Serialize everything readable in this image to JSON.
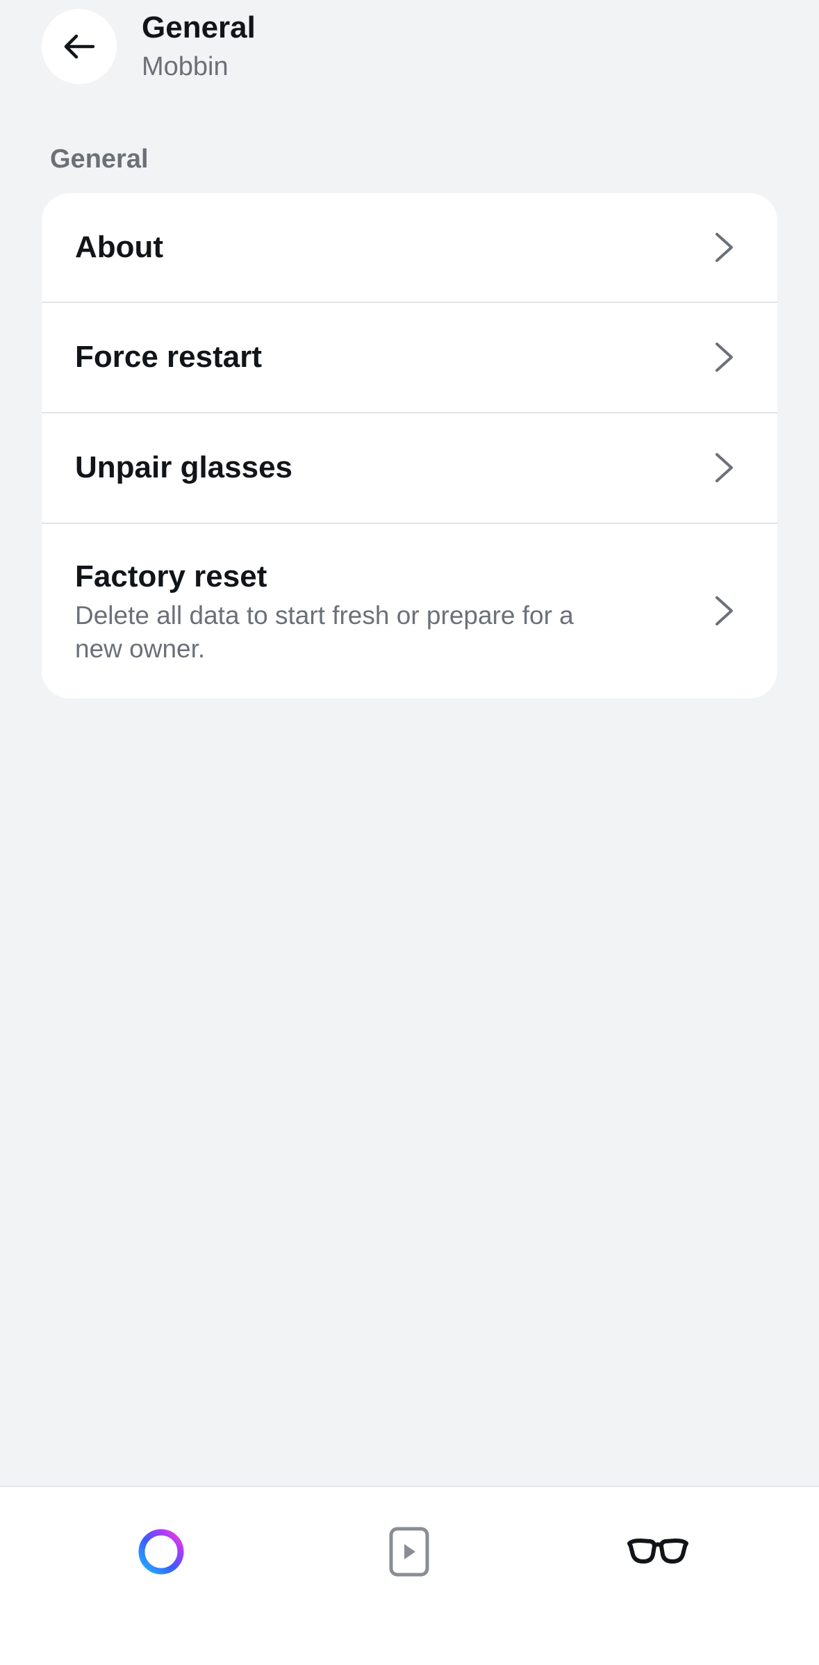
{
  "header": {
    "title": "General",
    "subtitle": "Mobbin",
    "back_icon": "arrow-left-icon"
  },
  "section": {
    "label": "General"
  },
  "settings": {
    "items": [
      {
        "label": "About",
        "icon": "chevron-right-icon"
      },
      {
        "label": "Force restart",
        "icon": "chevron-right-icon"
      },
      {
        "label": "Unpair glasses",
        "icon": "chevron-right-icon"
      },
      {
        "label": "Factory reset",
        "description": "Delete all data to start fresh or prepare for a new owner.",
        "icon": "chevron-right-icon"
      }
    ]
  },
  "bottom_nav": {
    "items": [
      {
        "icon": "meta-ai-ring-icon"
      },
      {
        "icon": "media-play-icon"
      },
      {
        "icon": "glasses-icon"
      }
    ]
  },
  "colors": {
    "background": "#f2f3f5",
    "card": "#ffffff",
    "primary_text": "#111418",
    "secondary_text": "#6b7078",
    "divider": "#e2e4e7",
    "chevron": "#6b7078"
  }
}
